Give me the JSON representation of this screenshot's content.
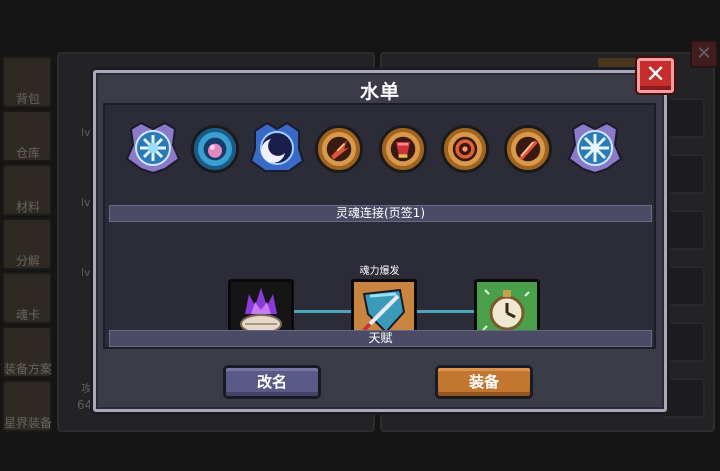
{
  "background": {
    "sidebar_items": [
      "背包",
      "仓库",
      "材料",
      "分解",
      "魂卡",
      "装备方案",
      "星界装备"
    ],
    "left_panel_level_labels": [
      "lv.",
      "lv.",
      "lv."
    ],
    "left_panel_stat_label": "攻",
    "left_panel_stat_value": "64"
  },
  "dialog": {
    "title": "水单",
    "close_label": "✕",
    "runes": [
      {
        "icon": "ice-flower-crest-icon",
        "color": "#6ab8e0"
      },
      {
        "icon": "pink-orb-rune-icon",
        "color": "#d26aa8"
      },
      {
        "icon": "dark-moon-crest-icon",
        "color": "#3a4fc0"
      },
      {
        "icon": "feather-fire-rune-icon",
        "color": "#c24a2a"
      },
      {
        "icon": "red-cup-rune-icon",
        "color": "#c2303a"
      },
      {
        "icon": "heart-swirl-rune-icon",
        "color": "#c85a30"
      },
      {
        "icon": "sword-fire-rune-icon",
        "color": "#d2502a"
      },
      {
        "icon": "snowflake-crest-icon",
        "color": "#6ab8e0"
      }
    ],
    "soul_section_label": "灵魂连接(页签1)",
    "soul_burst_label": "魂力爆发",
    "soul_slots": [
      {
        "icon": "purple-flame-shell-icon"
      },
      {
        "icon": "shield-sword-icon"
      },
      {
        "icon": "green-clock-icon"
      }
    ],
    "talent_label": "天赋",
    "rename_button": "改名",
    "equip_button": "装备"
  }
}
